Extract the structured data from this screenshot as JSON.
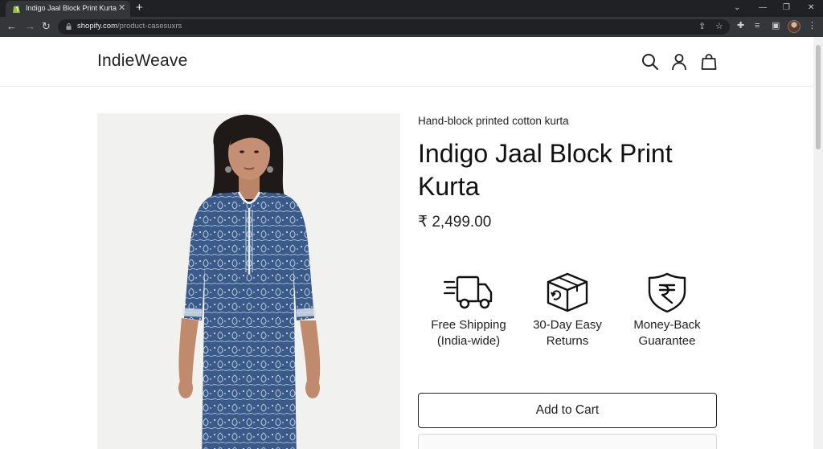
{
  "browser": {
    "tab_title": "Indigo Jaal Block Print Kurta",
    "url_host": "shopify.com",
    "url_path": "/product-casesuхrs"
  },
  "store": {
    "logo": "IndieWeave"
  },
  "product": {
    "subtitle": "Hand-block printed cotton kurta",
    "title": "Indigo Jaal Block Print Kurta",
    "price": "₹ 2,499.00",
    "features": [
      {
        "icon": "truck-icon",
        "label": "Free Shipping (India-wide)"
      },
      {
        "icon": "return-box-icon",
        "label": "30-Day Easy Returns"
      },
      {
        "icon": "rupee-shield-icon",
        "label": "Money-Back Guarantee"
      }
    ],
    "add_to_cart_label": "Add to Cart"
  },
  "colors": {
    "chrome_dark": "#202124",
    "chrome_toolbar": "#35363a",
    "kurta_indigo": "#3b5b8c",
    "text": "#222222"
  }
}
